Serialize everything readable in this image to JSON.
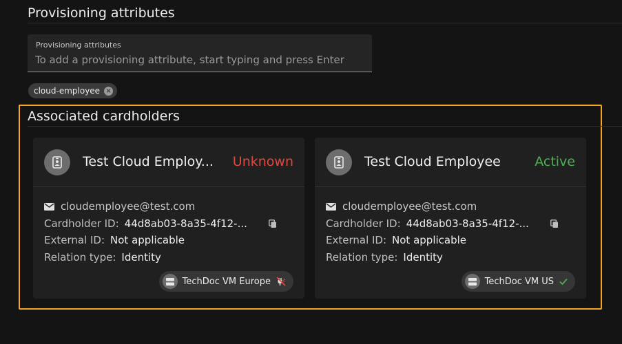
{
  "provisioning": {
    "section_title": "Provisioning attributes",
    "field_label": "Provisioning attributes",
    "field_placeholder": "To add a provisioning attribute, start typing and press Enter",
    "chips": [
      {
        "label": "cloud-employee",
        "remove_icon": "close-circle-icon"
      }
    ]
  },
  "associated": {
    "section_title": "Associated cardholders",
    "highlight_color": "#f5a623",
    "cards": [
      {
        "name": "Test Cloud Employ...",
        "status": "Unknown",
        "status_color": "#e0483e",
        "avatar_icon": "id-badge-icon",
        "email": "cloudemployee@test.com",
        "cardholder_id_label": "Cardholder ID:",
        "cardholder_id": "44d8ab03-8a35-4f12-...",
        "external_id_label": "External ID:",
        "external_id": "Not applicable",
        "relation_type_label": "Relation type:",
        "relation_type": "Identity",
        "server": "TechDoc VM Europe",
        "server_state_icon": "disconnected-plug-icon"
      },
      {
        "name": "Test Cloud Employee",
        "status": "Active",
        "status_color": "#4caf50",
        "avatar_icon": "id-badge-icon",
        "email": "cloudemployee@test.com",
        "cardholder_id_label": "Cardholder ID:",
        "cardholder_id": "44d8ab03-8a35-4f12-...",
        "external_id_label": "External ID:",
        "external_id": "Not applicable",
        "relation_type_label": "Relation type:",
        "relation_type": "Identity",
        "server": "TechDoc VM US",
        "server_state_icon": "checkmark-icon"
      }
    ]
  }
}
